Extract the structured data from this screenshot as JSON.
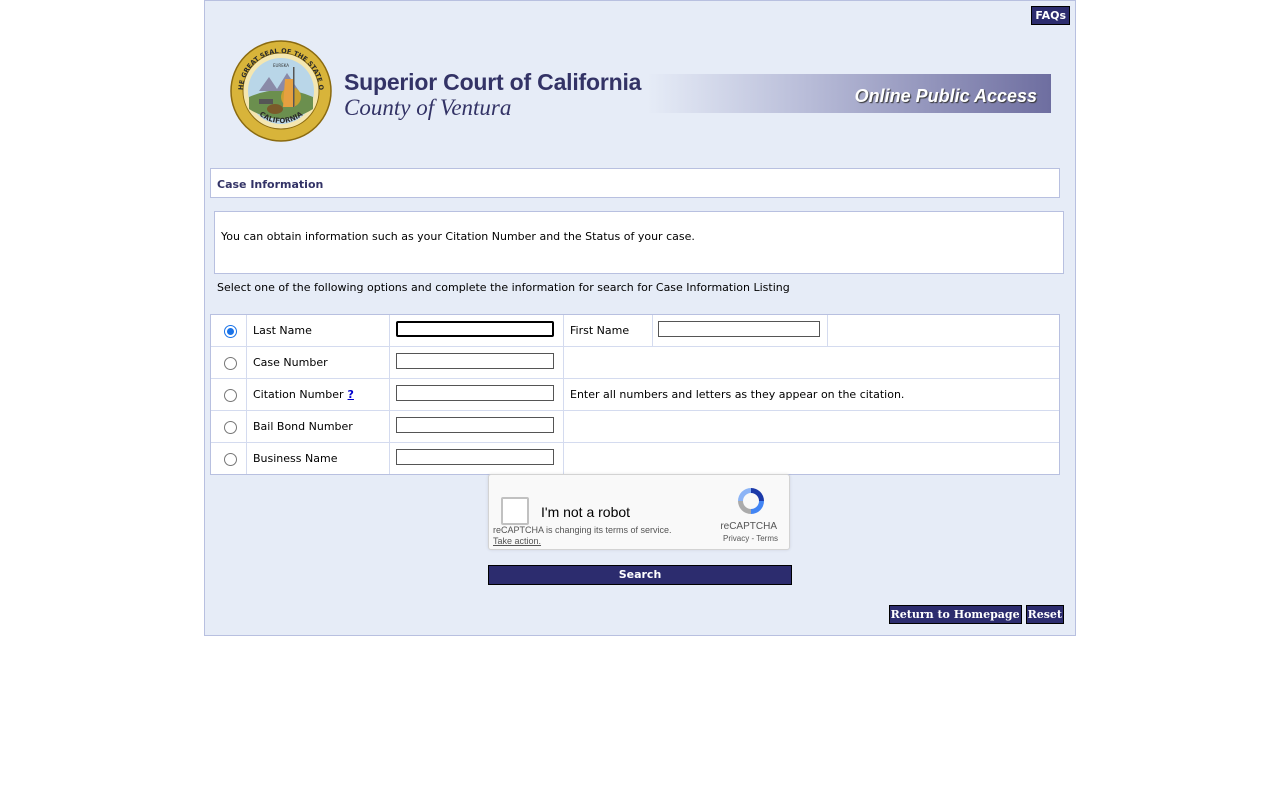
{
  "header": {
    "faq_label": "FAQs",
    "court_title": "Superior Court of California",
    "court_county": "County of Ventura",
    "banner_text": "Online Public Access",
    "seal_top_text": "THE GREAT SEAL OF THE STATE OF",
    "seal_bottom_text": "CALIFORNIA",
    "seal_motto": "EUREKA"
  },
  "section": {
    "title": "Case Information"
  },
  "info": {
    "text": "You can obtain information such as your Citation Number and the Status of your case."
  },
  "instructions": "Select one of the following options and complete the information for search for Case Information Listing",
  "search_options": [
    {
      "label": "Last Name",
      "selected": true,
      "value": ""
    },
    {
      "label": "Case Number",
      "selected": false,
      "value": ""
    },
    {
      "label": "Citation Number",
      "selected": false,
      "value": "",
      "help": "?",
      "note": "Enter all numbers and letters as they appear on the citation."
    },
    {
      "label": "Bail Bond Number",
      "selected": false,
      "value": ""
    },
    {
      "label": "Business Name",
      "selected": false,
      "value": ""
    }
  ],
  "first_name": {
    "label": "First Name",
    "value": ""
  },
  "recaptcha": {
    "label": "I'm not a robot",
    "brand": "reCAPTCHA",
    "terms": "Privacy - Terms",
    "notice": "reCAPTCHA is changing its terms of service.",
    "action": "Take action."
  },
  "actions": {
    "search_label": "Search",
    "homepage_label": "Return to Homepage",
    "reset_label": "Reset"
  },
  "colors": {
    "navy": "#2c2c6e",
    "page_bg": "#e6ecf7",
    "title_color": "#333366"
  }
}
